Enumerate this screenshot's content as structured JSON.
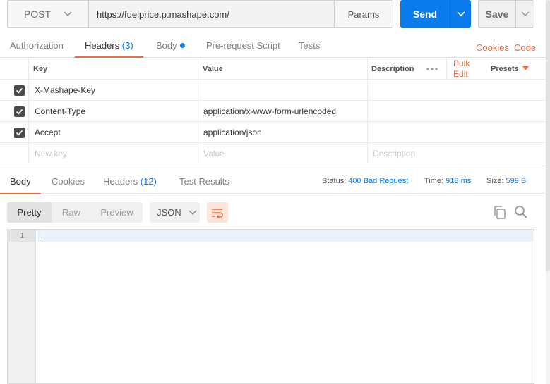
{
  "request": {
    "method": "POST",
    "url": "https://fuelprice.p.mashape.com/",
    "params_label": "Params",
    "send_label": "Send",
    "save_label": "Save"
  },
  "request_tabs": {
    "authorization": "Authorization",
    "headers": "Headers",
    "headers_count": "(3)",
    "body": "Body",
    "prerequest": "Pre-request Script",
    "tests": "Tests"
  },
  "links": {
    "cookies": "Cookies",
    "code": "Code"
  },
  "headers_table": {
    "col_key": "Key",
    "col_value": "Value",
    "col_description": "Description",
    "bulk_edit_line1": "Bulk",
    "bulk_edit_line2": "Edit",
    "presets": "Presets",
    "rows": [
      {
        "key": "X-Mashape-Key",
        "value": ""
      },
      {
        "key": "Content-Type",
        "value": "application/x-www-form-urlencoded"
      },
      {
        "key": "Accept",
        "value": "application/json"
      }
    ],
    "new_key_placeholder": "New key",
    "value_placeholder": "Value",
    "description_placeholder": "Description"
  },
  "response_tabs": {
    "body": "Body",
    "cookies": "Cookies",
    "headers": "Headers",
    "headers_count": "(12)",
    "test_results": "Test Results"
  },
  "status": {
    "status_label": "Status:",
    "status_value": "400 Bad Request",
    "time_label": "Time:",
    "time_value": "918 ms",
    "size_label": "Size:",
    "size_value": "599 B"
  },
  "viewer": {
    "pretty": "Pretty",
    "raw": "Raw",
    "preview": "Preview",
    "format": "JSON"
  },
  "editor": {
    "line_number": "1"
  },
  "colors": {
    "accent": "#f26b3a",
    "primary": "#097bed"
  },
  "icons": [
    "chevron-down-icon",
    "checkbox-checked-icon",
    "more-dots-icon",
    "wrap-lines-icon",
    "copy-icon",
    "search-icon"
  ]
}
